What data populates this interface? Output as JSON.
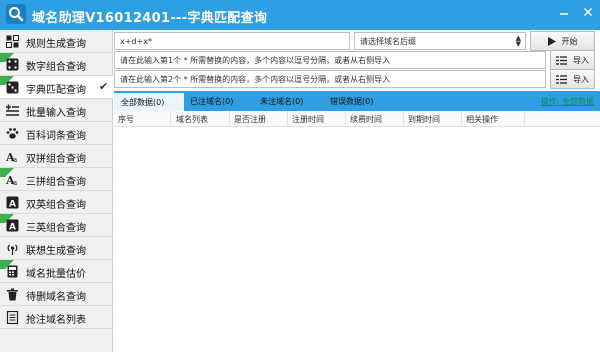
{
  "window": {
    "title": "域名助理V16012401---字典匹配查询",
    "minimize": "minimize",
    "close": "close"
  },
  "sidebar": {
    "items": [
      {
        "label": "规则生成查询",
        "icon": "grid-icon",
        "active": false,
        "new": false
      },
      {
        "label": "数字组合查询",
        "icon": "dice-icon",
        "active": false,
        "new": true
      },
      {
        "label": "字典匹配查询",
        "icon": "dice-icon",
        "active": true,
        "new": true
      },
      {
        "label": "批量输入查询",
        "icon": "list-plus-icon",
        "active": false,
        "new": false
      },
      {
        "label": "百科词条查询",
        "icon": "paw-icon",
        "active": false,
        "new": false
      },
      {
        "label": "双拼组合查询",
        "icon": "font-icon",
        "active": false,
        "new": false
      },
      {
        "label": "三拼组合查询",
        "icon": "font-icon",
        "active": false,
        "new": true
      },
      {
        "label": "双英组合查询",
        "icon": "letter-a-icon",
        "active": false,
        "new": false
      },
      {
        "label": "三英组合查询",
        "icon": "letter-a-icon",
        "active": false,
        "new": true
      },
      {
        "label": "联想生成查询",
        "icon": "broadcast-icon",
        "active": false,
        "new": false
      },
      {
        "label": "域名批量估价",
        "icon": "calculator-icon",
        "active": false,
        "new": true
      },
      {
        "label": "待删域名查询",
        "icon": "trash-icon",
        "active": false,
        "new": false
      },
      {
        "label": "抢注域名列表",
        "icon": "document-icon",
        "active": false,
        "new": false
      }
    ]
  },
  "query": {
    "pattern_value": "x+d+x*",
    "suffix_placeholder": "请选择域名后缀",
    "start_label": "开始",
    "input1_value": "请在此输入第1个 * 所需替换的内容，多个内容以逗号分隔，或者从右侧导入",
    "input2_value": "请在此输入第2个 * 所需替换的内容，多个内容以逗号分隔，或者从右侧导入",
    "import_label": "导入"
  },
  "tabs": [
    {
      "label": "全部数据(0)"
    },
    {
      "label": "已注域名(0)"
    },
    {
      "label": "未注域名(0)"
    },
    {
      "label": "错误数据(0)"
    }
  ],
  "operation_link": "操作: 全部数据",
  "table": {
    "columns": [
      "序号",
      "域名列表",
      "是否注册",
      "注册时间",
      "续费时间",
      "到期时间",
      "相关操作"
    ]
  },
  "colors": {
    "accent": "#2f9fe3",
    "new_badge": "#3cb04a",
    "link": "#0a8d4e"
  }
}
